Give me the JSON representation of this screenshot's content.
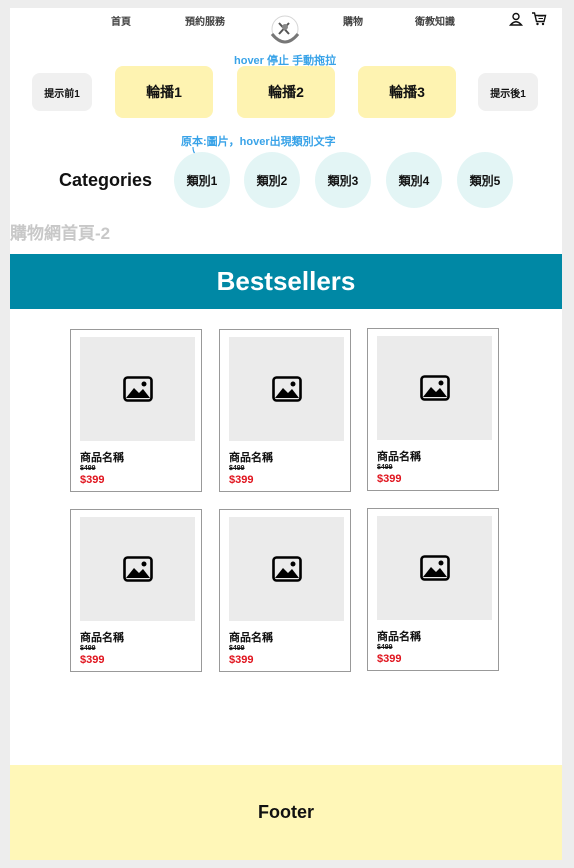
{
  "nav": {
    "items": [
      "首頁",
      "預約服務",
      "購物",
      "衛教知識"
    ],
    "icons": [
      "user-icon",
      "cart-icon"
    ]
  },
  "notes": {
    "carousel": "hover 停止 手動拖拉",
    "category": "原本:圖片，hover出現類別文字"
  },
  "carousel": {
    "prev": "提示前1",
    "slides": [
      "輪播1",
      "輪播2",
      "輪播3"
    ],
    "next": "提示後1"
  },
  "categories": {
    "title": "Categories",
    "items": [
      "類別1",
      "類別2",
      "類別3",
      "類別4",
      "類別5"
    ]
  },
  "page_label": "購物網首頁-2",
  "bestsellers": {
    "title": "Bestsellers"
  },
  "products": [
    {
      "name": "商品名稱",
      "old_price": "$499",
      "price": "$399"
    },
    {
      "name": "商品名稱",
      "old_price": "$499",
      "price": "$399"
    },
    {
      "name": "商品名稱",
      "old_price": "$499",
      "price": "$399"
    },
    {
      "name": "商品名稱",
      "old_price": "$499",
      "price": "$399"
    },
    {
      "name": "商品名稱",
      "old_price": "$499",
      "price": "$399"
    },
    {
      "name": "商品名稱",
      "old_price": "$499",
      "price": "$399"
    }
  ],
  "footer": {
    "label": "Footer"
  },
  "colors": {
    "banner": "#0088a5",
    "slide": "#fef3b1",
    "category": "#e3f5f5",
    "price": "#e0141e",
    "note": "#39a3e8",
    "footer": "#fff7b8"
  }
}
